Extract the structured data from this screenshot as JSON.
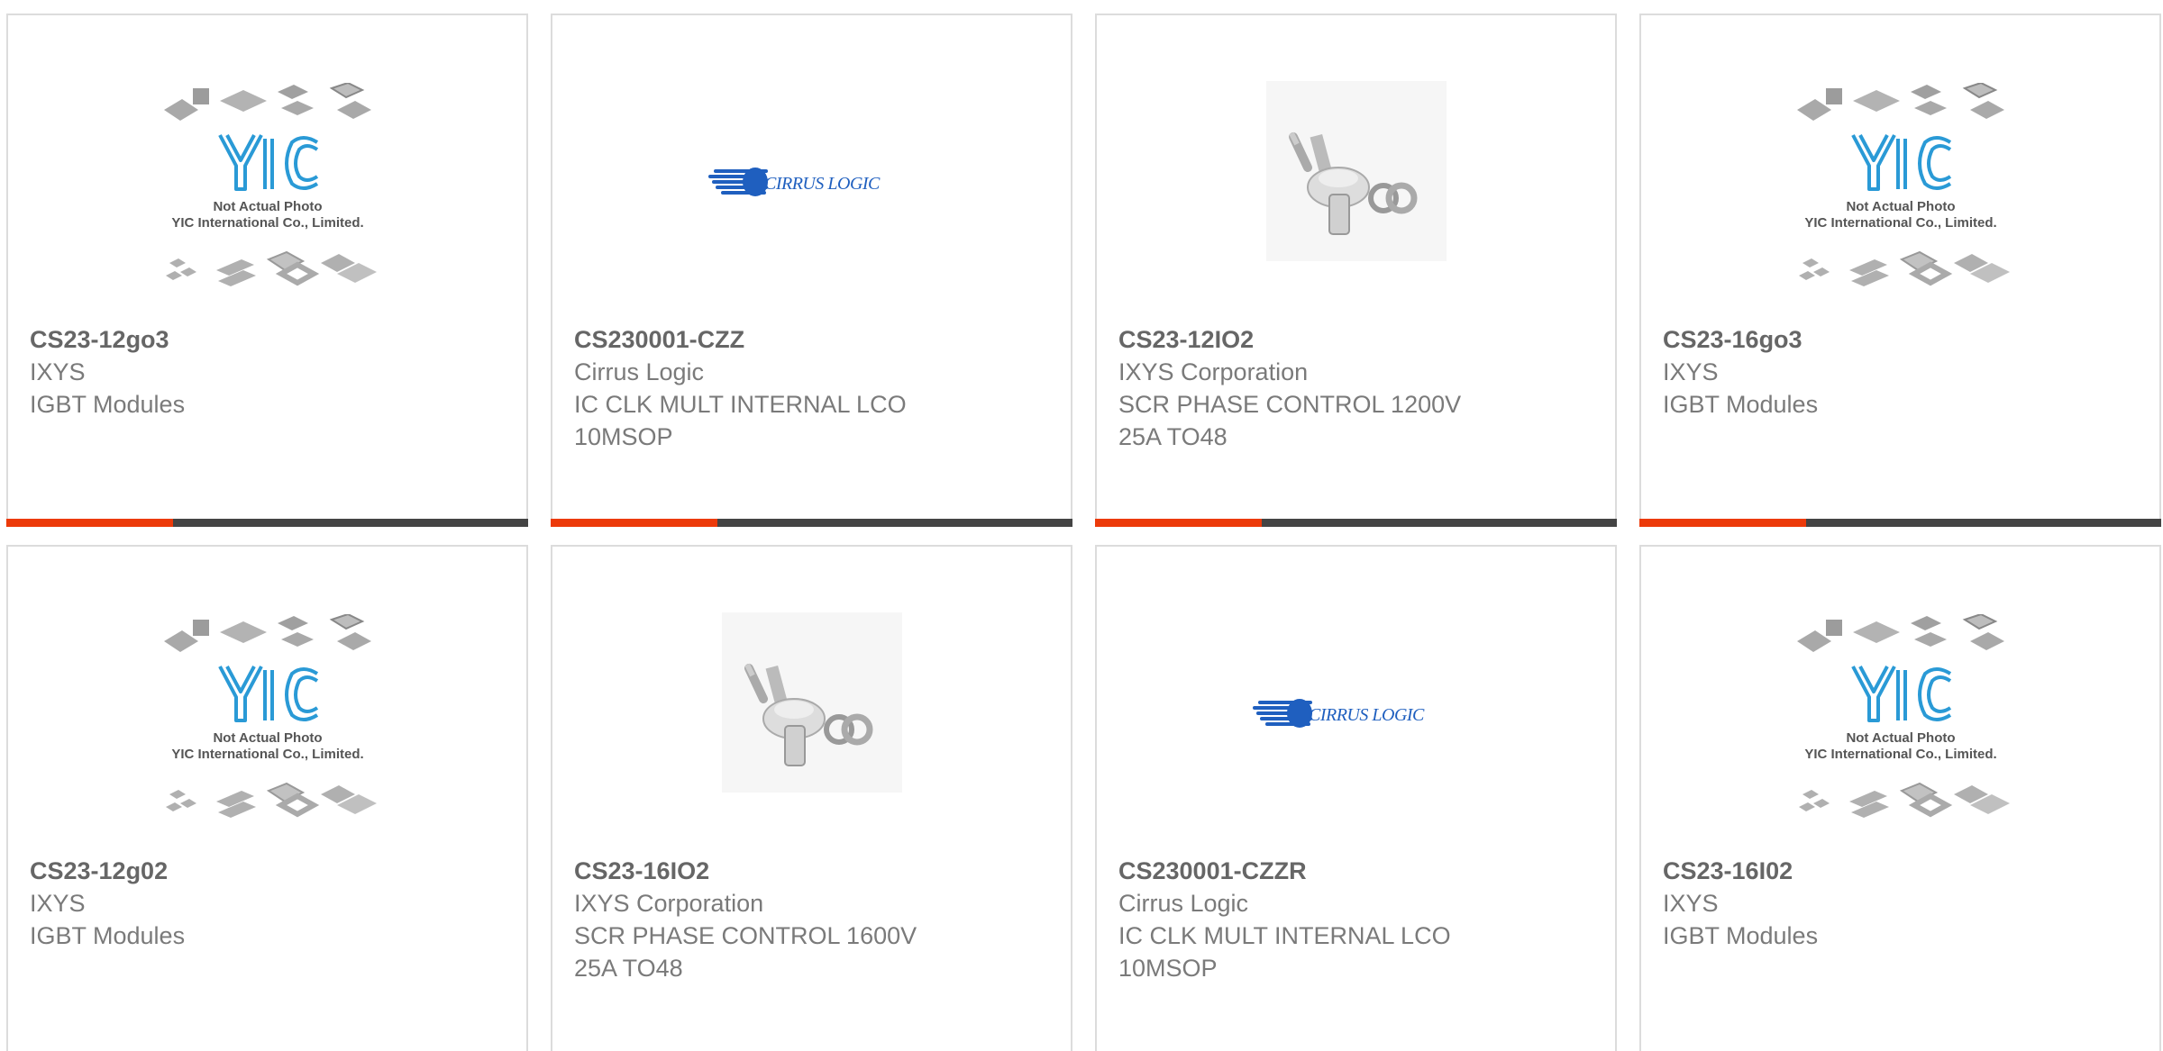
{
  "colors": {
    "accent": "#ec3a0a",
    "bar_track": "#444444",
    "yic_blue": "#2a9ad6",
    "cirrus_blue": "#1f5fbf",
    "card_border": "#dcdcdc",
    "text": "#7a7a7a"
  },
  "logos": {
    "yic_note_line1": "Not Actual Photo",
    "yic_note_line2": "YIC International Co., Limited.",
    "cirrus": "CIRRUS LOGIC"
  },
  "products": [
    {
      "part": "CS23-12go3",
      "manufacturer": "IXYS",
      "description": "IGBT Modules",
      "image": "yic-placeholder",
      "progress": 0.32
    },
    {
      "part": "CS230001-CZZ",
      "manufacturer": "Cirrus Logic",
      "description": "IC CLK MULT INTERNAL LCO\n10MSOP",
      "image": "cirrus-logic-logo",
      "progress": 0.32
    },
    {
      "part": "CS23-12IO2",
      "manufacturer": "IXYS Corporation",
      "description": "SCR PHASE CONTROL 1200V\n25A TO48",
      "image": "scr-device-photo",
      "progress": 0.32
    },
    {
      "part": "CS23-16go3",
      "manufacturer": "IXYS",
      "description": "IGBT Modules",
      "image": "yic-placeholder",
      "progress": 0.32
    },
    {
      "part": "CS23-12g02",
      "manufacturer": "IXYS",
      "description": "IGBT Modules",
      "image": "yic-placeholder"
    },
    {
      "part": "CS23-16IO2",
      "manufacturer": "IXYS Corporation",
      "description": "SCR PHASE CONTROL 1600V\n25A TO48",
      "image": "scr-device-photo"
    },
    {
      "part": "CS230001-CZZR",
      "manufacturer": "Cirrus Logic",
      "description": "IC CLK MULT INTERNAL LCO\n10MSOP",
      "image": "cirrus-logic-logo"
    },
    {
      "part": "CS23-16I02",
      "manufacturer": "IXYS",
      "description": "IGBT Modules",
      "image": "yic-placeholder"
    }
  ]
}
